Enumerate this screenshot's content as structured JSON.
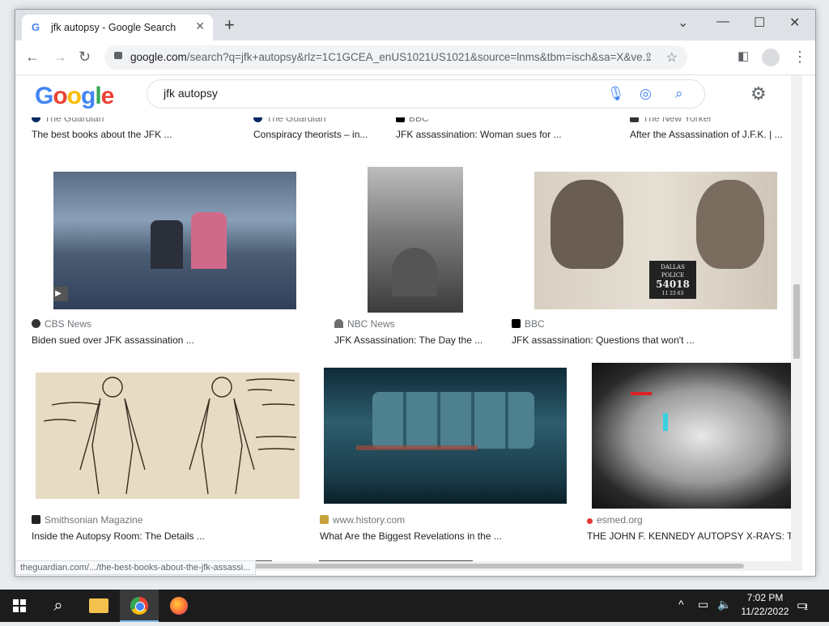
{
  "browser": {
    "tab_title": "jfk autopsy - Google Search",
    "new_tab_label": "+",
    "url_host": "google.com",
    "url_rest": "/search?q=jfk+autopsy&rlz=1C1GCEA_enUS1021US1021&source=lnms&tbm=isch&sa=X&ve...",
    "status_url": "theguardian.com/.../the-best-books-about-the-jfk-assassi..."
  },
  "google": {
    "logo": [
      "G",
      "o",
      "o",
      "g",
      "l",
      "e"
    ],
    "query": "jfk autopsy"
  },
  "results": {
    "row0": [
      {
        "source": "The Guardian",
        "caption": "The best books about the JFK ..."
      },
      {
        "source": "The Guardian",
        "caption": "Conspiracy theorists – in..."
      },
      {
        "source": "BBC",
        "caption": "JFK assassination: Woman sues for ..."
      },
      {
        "source": "The New Yorker",
        "caption": "After the Assassination of J.F.K. | ..."
      }
    ],
    "row1": [
      {
        "source": "CBS News",
        "caption": "Biden sued over JFK assassination ..."
      },
      {
        "source": "NBC News",
        "caption": "JFK Assassination: The Day the ..."
      },
      {
        "source": "BBC",
        "caption": "JFK assassination: Questions that won't ..."
      }
    ],
    "row2": [
      {
        "source": "Smithsonian Magazine",
        "caption": "Inside the Autopsy Room: The Details ..."
      },
      {
        "source": "www.history.com",
        "caption": "What Are the Biggest Revelations in the ..."
      },
      {
        "source": "esmed.org",
        "caption": "THE JOHN F. KENNEDY AUTOPSY X-RAYS: T..."
      }
    ],
    "mugshot_board": [
      "DALLAS",
      "POLICE",
      "54018",
      "11 23 63"
    ]
  },
  "taskbar": {
    "time": "7:02 PM",
    "date": "11/22/2022",
    "notification_count": "1"
  }
}
